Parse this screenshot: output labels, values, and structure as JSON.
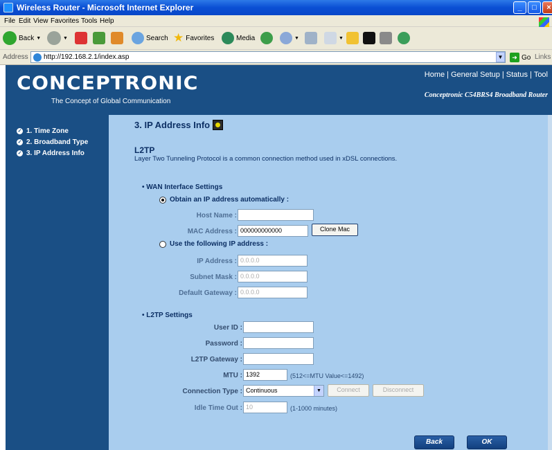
{
  "window": {
    "title": "Wireless Router - Microsoft Internet Explorer",
    "min": "_",
    "max": "□",
    "close": "×"
  },
  "menu": [
    "File",
    "Edit",
    "View",
    "Favorites",
    "Tools",
    "Help"
  ],
  "toolbar": {
    "back": "Back",
    "search": "Search",
    "favorites": "Favorites",
    "media": "Media"
  },
  "address": {
    "label": "Address",
    "url": "http://192.168.2.1/index.asp",
    "go": "Go",
    "links": "Links"
  },
  "header": {
    "logo": "CONCEPTRONIC",
    "tagline": "The Concept of Global Communication",
    "nav": [
      "Home",
      "General Setup",
      "Status",
      "Tool"
    ],
    "model": "Conceptronic C54BRS4 Broadband Router"
  },
  "sidebar": {
    "items": [
      {
        "label": "1. Time Zone"
      },
      {
        "label": "2. Broadband Type"
      },
      {
        "label": "3. IP Address Info"
      }
    ]
  },
  "content": {
    "title": "3. IP Address Info",
    "section": "L2TP",
    "description": "Layer Two Tunneling Protocol is a common connection method used in xDSL connections.",
    "wan": {
      "heading": "• WAN Interface Settings",
      "auto_label": "Obtain an IP address automatically :",
      "host_label": "Host Name :",
      "host_value": "",
      "mac_label": "MAC Address :",
      "mac_value": "000000000000",
      "clone_label": "Clone Mac",
      "static_label": "Use the following IP address :",
      "ip_label": "IP Address :",
      "ip_value": "0.0.0.0",
      "mask_label": "Subnet Mask :",
      "mask_value": "0.0.0.0",
      "gw_label": "Default Gateway :",
      "gw_value": "0.0.0.0"
    },
    "l2tp": {
      "heading": "• L2TP Settings",
      "user_label": "User ID :",
      "user_value": "",
      "pass_label": "Password :",
      "pass_value": "",
      "gateway_label": "L2TP Gateway :",
      "gateway_value": "",
      "mtu_label": "MTU :",
      "mtu_value": "1392",
      "mtu_hint": "(512<=MTU Value<=1492)",
      "conn_label": "Connection Type :",
      "conn_value": "Continuous",
      "connect_label": "Connect",
      "disconnect_label": "Disconnect",
      "idle_label": "Idle Time Out :",
      "idle_value": "10",
      "idle_hint": "(1-1000 minutes)"
    },
    "back_label": "Back",
    "ok_label": "OK"
  }
}
